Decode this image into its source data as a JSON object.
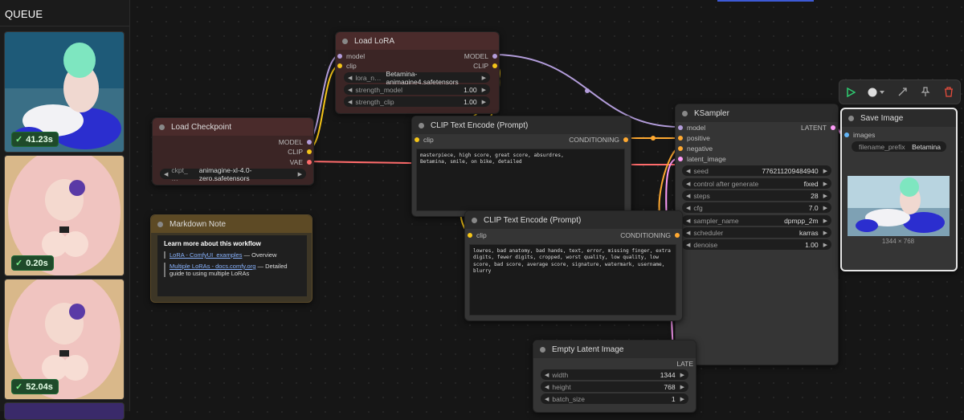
{
  "queue": {
    "title": "QUEUE",
    "items": [
      {
        "time": "41.23s"
      },
      {
        "time": "0.20s"
      },
      {
        "time": "52.04s"
      }
    ]
  },
  "toolbar": {
    "icons": [
      "play-icon",
      "circle-dropdown-icon",
      "bypass-icon",
      "pin-icon",
      "delete-icon"
    ],
    "accent_play": "#2ecc71",
    "accent_delete": "#e74c3c"
  },
  "nodes": {
    "load_lora": {
      "title": "Load LoRA",
      "inputs": [
        "model",
        "clip"
      ],
      "outputs": [
        "MODEL",
        "CLIP"
      ],
      "widgets": [
        {
          "label": "lora_n…",
          "value": "Betamina-animagine4.safetensors"
        },
        {
          "label": "strength_model",
          "value": "1.00"
        },
        {
          "label": "strength_clip",
          "value": "1.00"
        }
      ]
    },
    "load_checkpoint": {
      "title": "Load Checkpoint",
      "outputs": [
        "MODEL",
        "CLIP",
        "VAE"
      ],
      "widget": {
        "label": "ckpt_ …",
        "value": "animagine-xl-4.0-zero.safetensors"
      }
    },
    "clip_pos": {
      "title": "CLIP Text Encode (Prompt)",
      "input": "clip",
      "output": "CONDITIONING",
      "text": "masterpiece, high score, great score, absurdres,\nBetamina, smile, on bike, detailed"
    },
    "clip_neg": {
      "title": "CLIP Text Encode (Prompt)",
      "input": "clip",
      "output": "CONDITIONING",
      "text": "lowres, bad anatomy, bad hands, text, error, missing finger, extra digits, fewer digits, cropped, worst quality, low quality, low score, bad score, average score, signature, watermark, username, blurry"
    },
    "markdown": {
      "title": "Markdown Note",
      "heading": "Learn more about this workflow",
      "link1": "LoRA - ComfyUI_examples",
      "link1_suffix": " — Overview",
      "link2": "Multiple LoRAs - docs.comfy.org",
      "link2_suffix": " — Detailed guide to using multiple LoRAs"
    },
    "ksampler": {
      "title": "KSampler",
      "inputs": [
        "model",
        "positive",
        "negative",
        "latent_image"
      ],
      "output": "LATENT",
      "widgets": [
        {
          "label": "seed",
          "value": "776211209484940"
        },
        {
          "label": "control after generate",
          "value": "fixed"
        },
        {
          "label": "steps",
          "value": "28"
        },
        {
          "label": "cfg",
          "value": "7.0"
        },
        {
          "label": "sampler_name",
          "value": "dpmpp_2m"
        },
        {
          "label": "scheduler",
          "value": "karras"
        },
        {
          "label": "denoise",
          "value": "1.00"
        }
      ]
    },
    "save_image": {
      "title": "Save Image",
      "input": "images",
      "widget": {
        "label": "filename_prefix",
        "value": "Betamina"
      },
      "size_label": "1344 × 768"
    },
    "empty_latent": {
      "title": "Empty Latent Image",
      "output": "LATE",
      "widgets": [
        {
          "label": "width",
          "value": "1344"
        },
        {
          "label": "height",
          "value": "768"
        },
        {
          "label": "batch_size",
          "value": "1"
        }
      ]
    }
  },
  "colors": {
    "model": "#b39ddb",
    "clip": "#f5c518",
    "vae": "#ff6b6b",
    "conditioning": "#ffa931",
    "latent": "#ff9cf9",
    "image": "#64b5f6"
  }
}
